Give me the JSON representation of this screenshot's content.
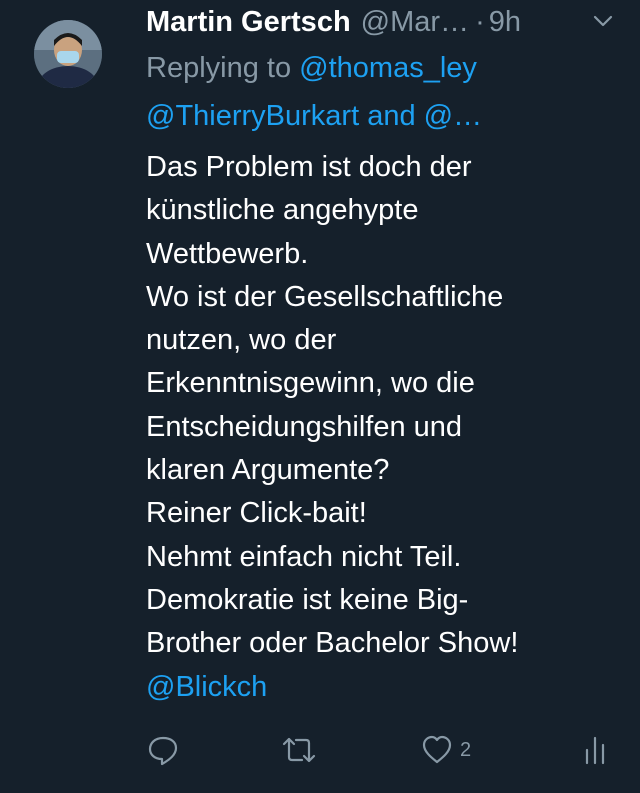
{
  "tweet": {
    "author_name": "Martin Gertsch",
    "author_handle": "@Mar…",
    "separator": "·",
    "time": "9h",
    "replying_prefix": "Replying to",
    "replying_to_1": "@thomas_ley",
    "replying_to_line2": "@ThierryBurkart and @…",
    "body_lines": [
      "Das Problem ist doch der",
      "künstliche angehypte",
      "Wettbewerb.",
      "Wo ist der Gesellschaftliche",
      "nutzen, wo der",
      "Erkenntnisgewinn, wo die",
      "Entscheidungshilfen und",
      "klaren Argumente?",
      "Reiner Click-bait!",
      "Nehmt einfach nicht Teil.",
      "Demokratie ist keine Big-",
      "Brother oder Bachelor Show!"
    ],
    "mention": "@Blickch",
    "like_count": "2"
  },
  "colors": {
    "background": "#15202b",
    "text_primary": "#ffffff",
    "text_secondary": "#8899a6",
    "link": "#1da1f2"
  },
  "icons": {
    "more": "chevron-down-icon",
    "reply": "reply-icon",
    "retweet": "retweet-icon",
    "like": "heart-icon",
    "analytics": "analytics-icon"
  }
}
